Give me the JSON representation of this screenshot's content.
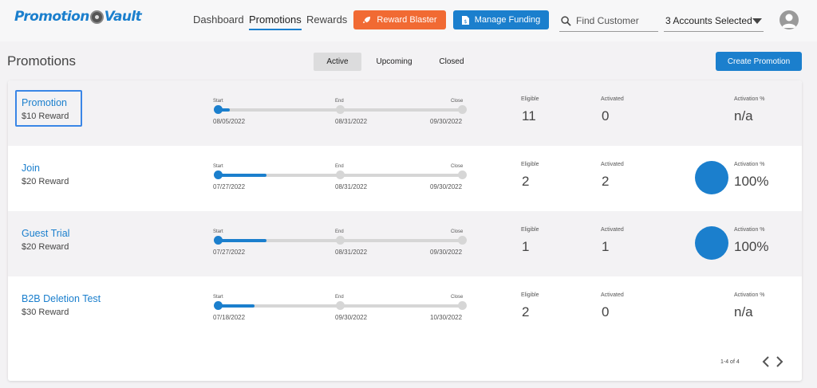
{
  "header": {
    "logo": "Promotion Vault",
    "nav": [
      {
        "label": "Dashboard"
      },
      {
        "label": "Promotions"
      },
      {
        "label": "Rewards"
      }
    ],
    "reward_blaster_label": "Reward Blaster",
    "manage_funding_label": "Manage Funding",
    "search_placeholder": "Find Customer",
    "accounts_label": "3 Accounts Selected",
    "colors": {
      "accent": "#1b7fcd",
      "orange": "#f16a33"
    }
  },
  "toolbar": {
    "title": "Promotions",
    "tabs": [
      {
        "label": "Active",
        "selected": true
      },
      {
        "label": "Upcoming",
        "selected": false
      },
      {
        "label": "Closed",
        "selected": false
      }
    ],
    "create_label": "Create Promotion"
  },
  "timeline_labels": {
    "start": "Start",
    "end": "End",
    "close": "Close"
  },
  "stat_labels": {
    "eligible": "Eligible",
    "activated": "Activated",
    "activation": "Activation %"
  },
  "promotions": [
    {
      "name": "Promotion",
      "reward": "$10 Reward",
      "start": "08/05/2022",
      "end": "08/31/2022",
      "close": "09/30/2022",
      "progress": 0.05,
      "eligible": "11",
      "activated": "0",
      "activation": "n/a",
      "activation_fraction": 0
    },
    {
      "name": "Join",
      "reward": "$20 Reward",
      "start": "07/27/2022",
      "end": "08/31/2022",
      "close": "09/30/2022",
      "progress": 0.2,
      "eligible": "2",
      "activated": "2",
      "activation": "100%",
      "activation_fraction": 1
    },
    {
      "name": "Guest Trial",
      "reward": "$20 Reward",
      "start": "07/27/2022",
      "end": "08/31/2022",
      "close": "09/30/2022",
      "progress": 0.2,
      "eligible": "1",
      "activated": "1",
      "activation": "100%",
      "activation_fraction": 1
    },
    {
      "name": "B2B Deletion Test",
      "reward": "$30 Reward",
      "start": "07/18/2022",
      "end": "09/30/2022",
      "close": "10/30/2022",
      "progress": 0.15,
      "eligible": "2",
      "activated": "0",
      "activation": "n/a",
      "activation_fraction": 0
    }
  ],
  "pagination": {
    "label": "1-4 of 4"
  }
}
